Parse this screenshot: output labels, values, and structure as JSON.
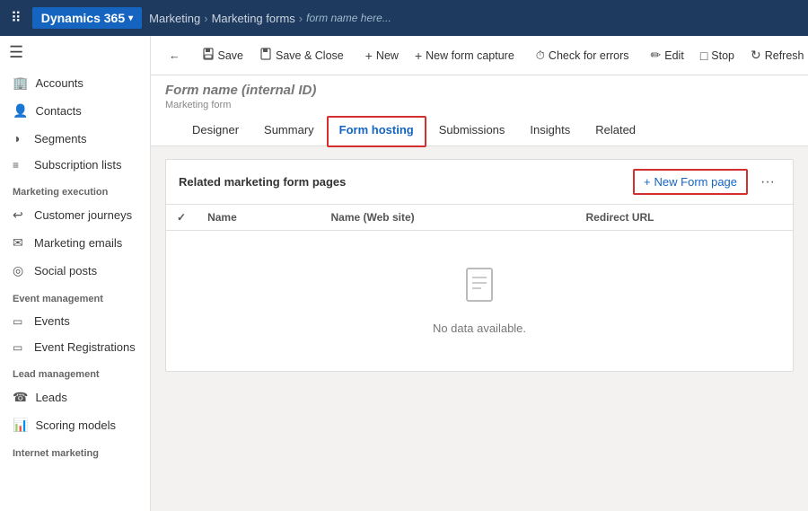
{
  "topnav": {
    "waffle": "⠿",
    "app_name": "Dynamics 365",
    "chevron": "∨",
    "breadcrumb": [
      "Marketing",
      "Marketing forms"
    ],
    "current_page": "Form name here..."
  },
  "toolbar": {
    "back_icon": "←",
    "save_label": "Save",
    "save_icon": "💾",
    "save_close_label": "Save & Close",
    "save_close_icon": "💾",
    "new_label": "New",
    "new_icon": "+",
    "new_form_capture_label": "New form capture",
    "new_form_capture_icon": "+",
    "check_errors_label": "Check for errors",
    "check_errors_icon": "⏱",
    "edit_label": "Edit",
    "edit_icon": "✏",
    "stop_label": "Stop",
    "stop_icon": "□",
    "refresh_label": "Refresh",
    "refresh_icon": "↻"
  },
  "record": {
    "title": "Form name (internal ID)",
    "subtitle": "Marketing form"
  },
  "tabs": [
    {
      "id": "designer",
      "label": "Designer"
    },
    {
      "id": "summary",
      "label": "Summary"
    },
    {
      "id": "form_hosting",
      "label": "Form hosting",
      "active": true
    },
    {
      "id": "submissions",
      "label": "Submissions"
    },
    {
      "id": "insights",
      "label": "Insights"
    },
    {
      "id": "related",
      "label": "Related"
    }
  ],
  "section": {
    "title": "Related marketing form pages",
    "new_form_page_label": "New Form page",
    "new_form_page_icon": "+",
    "more_icon": "···",
    "table": {
      "columns": [
        {
          "id": "check",
          "label": "✓"
        },
        {
          "id": "name",
          "label": "Name"
        },
        {
          "id": "name_website",
          "label": "Name (Web site)"
        },
        {
          "id": "redirect_url",
          "label": "Redirect URL"
        }
      ],
      "no_data_icon": "📄",
      "no_data_text": "No data available."
    }
  },
  "sidebar": {
    "toggle_icon": "☰",
    "items_top": [
      {
        "id": "accounts",
        "icon": "🏢",
        "label": "Accounts"
      },
      {
        "id": "contacts",
        "icon": "👤",
        "label": "Contacts"
      },
      {
        "id": "segments",
        "icon": "◑",
        "label": "Segments"
      },
      {
        "id": "subscription_lists",
        "icon": "☰",
        "label": "Subscription lists"
      }
    ],
    "section_marketing": "Marketing execution",
    "items_marketing": [
      {
        "id": "customer_journeys",
        "icon": "↩",
        "label": "Customer journeys"
      },
      {
        "id": "marketing_emails",
        "icon": "✉",
        "label": "Marketing emails"
      },
      {
        "id": "social_posts",
        "icon": "◎",
        "label": "Social posts"
      }
    ],
    "section_events": "Event management",
    "items_events": [
      {
        "id": "events",
        "icon": "📅",
        "label": "Events"
      },
      {
        "id": "event_registrations",
        "icon": "📋",
        "label": "Event Registrations"
      }
    ],
    "section_leads": "Lead management",
    "items_leads": [
      {
        "id": "leads",
        "icon": "☎",
        "label": "Leads"
      },
      {
        "id": "scoring_models",
        "icon": "📊",
        "label": "Scoring models"
      }
    ],
    "section_internet": "Internet marketing"
  }
}
